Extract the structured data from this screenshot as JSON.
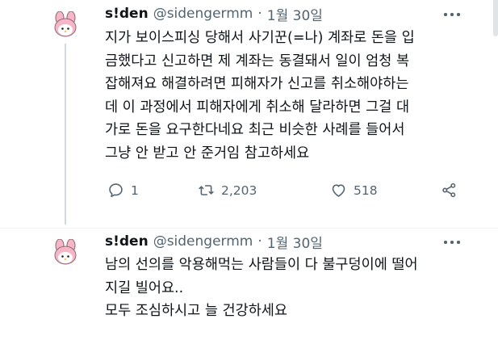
{
  "tweets": [
    {
      "author": {
        "name": "s!den",
        "handle": "@sidengermm",
        "separator": "·",
        "date": "1월 30일"
      },
      "text": "지가 보이스피싱 당해서 사기꾼(=나) 계좌로 돈을 입\n금했다고 신고하면 제 계좌는 동결돼서 일이 엄청 복\n잡해져요 해결하려면 피해자가 신고를 취소해야하는\n데 이 과정에서 피해자에게 취소해 달라하면 그걸 대\n가로 돈을 요구한다네요 최근 비슷한 사례를 들어서\n그냥 안 받고 안 준거임 참고하세요",
      "stats": {
        "replies": "1",
        "retweets": "2,203",
        "likes": "518"
      }
    },
    {
      "author": {
        "name": "s!den",
        "handle": "@sidengermm",
        "separator": "·",
        "date": "1월 30일"
      },
      "text": "남의 선의를 악용해먹는 사람들이 다 불구덩이에 떨어\n지길 빌어요..\n모두 조심하시고 늘 건강하세요"
    }
  ],
  "icons": [
    "avatar-my-melody",
    "more-icon",
    "reply-icon",
    "retweet-icon",
    "like-icon",
    "share-icon"
  ],
  "colors": {
    "text": "#0f1419",
    "secondary": "#536471",
    "divider": "#eff3f4",
    "avatar_pink": "#f6b6c8"
  }
}
